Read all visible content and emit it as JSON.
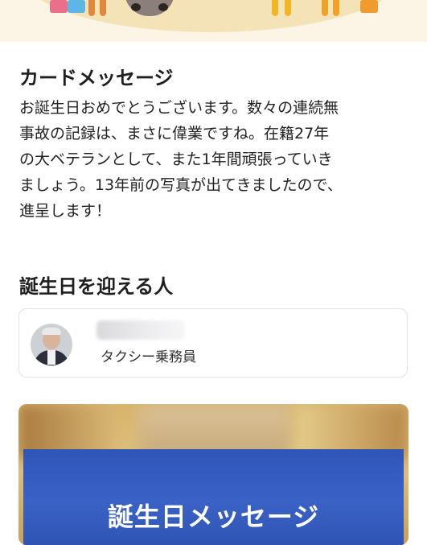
{
  "card_message": {
    "title": "カードメッセージ",
    "lines": [
      "お誕生日おめでとうございます。数々の連続無",
      "事故の記録は、まさに偉業ですね。在籍27年",
      "の大ベテランとして、また1年間頑張っていき",
      "ましょう。13年前の写真が出てきましたので、",
      "進呈します！"
    ]
  },
  "birthday_person": {
    "title": "誕生日を迎える人",
    "role": "タクシー乗務員"
  },
  "photo_card": {
    "title": "誕生日メッセージ"
  }
}
